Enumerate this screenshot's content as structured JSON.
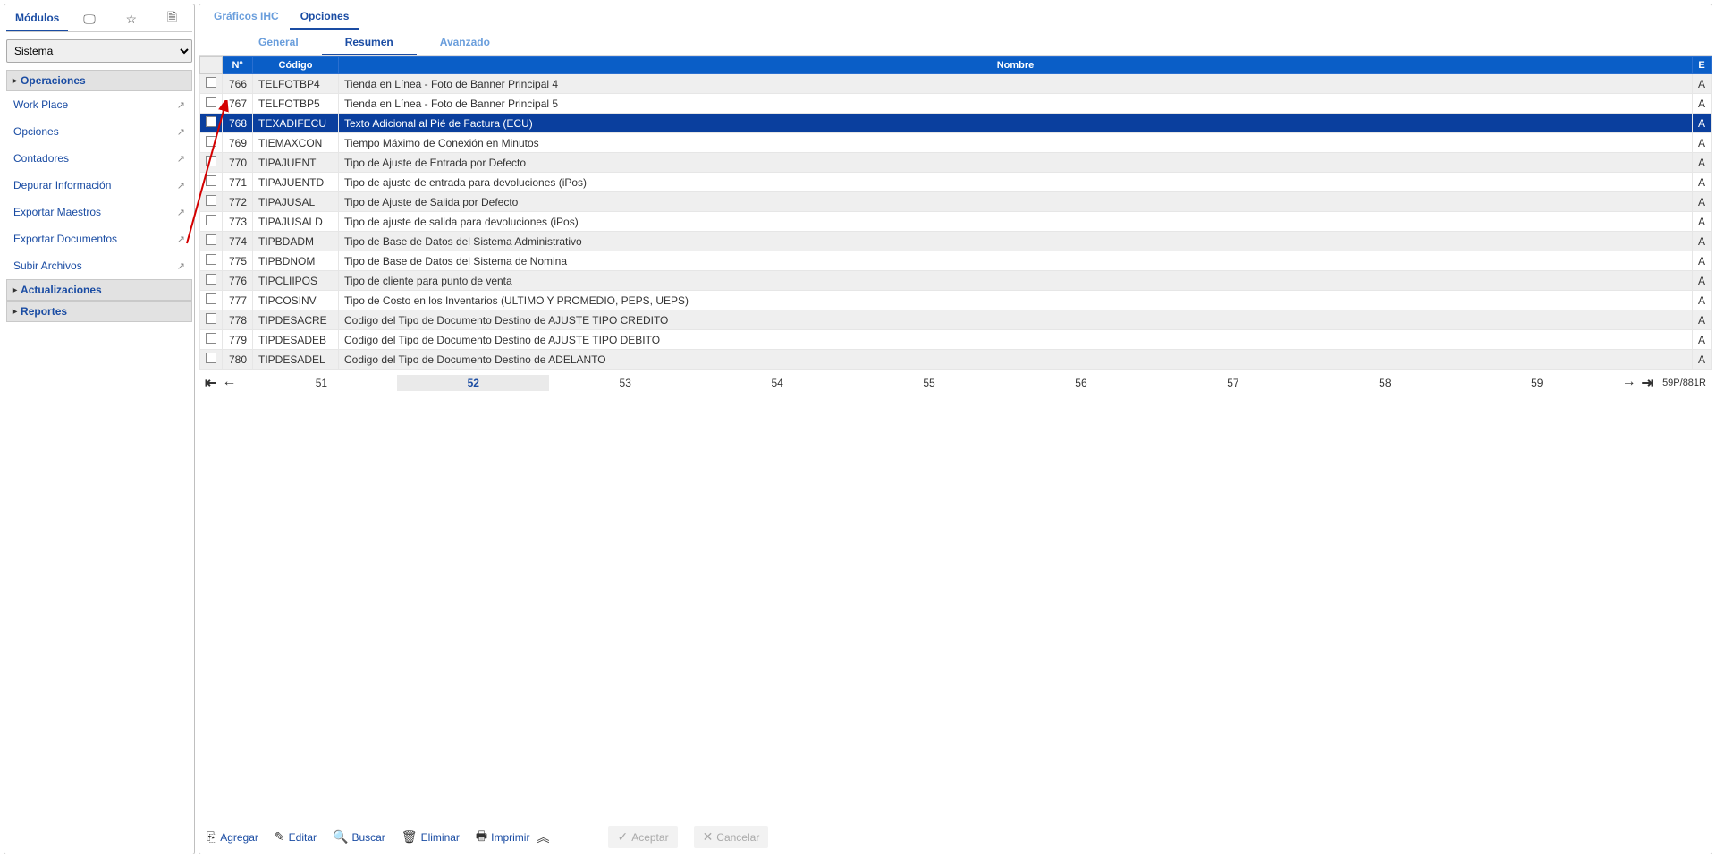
{
  "sidebar": {
    "tab_label": "Módulos",
    "select_value": "Sistema",
    "groups": [
      {
        "label": "Operaciones",
        "expanded": true,
        "items": [
          {
            "label": "Work Place"
          },
          {
            "label": "Opciones"
          },
          {
            "label": "Contadores"
          },
          {
            "label": "Depurar Información"
          },
          {
            "label": "Exportar Maestros"
          },
          {
            "label": "Exportar Documentos"
          },
          {
            "label": "Subir Archivos"
          }
        ]
      },
      {
        "label": "Actualizaciones",
        "expanded": false,
        "items": []
      },
      {
        "label": "Reportes",
        "expanded": false,
        "items": []
      }
    ]
  },
  "tabs": {
    "top": [
      {
        "label": "Gráficos IHC",
        "active": false
      },
      {
        "label": "Opciones",
        "active": true
      }
    ],
    "sub": [
      {
        "label": "General",
        "active": false
      },
      {
        "label": "Resumen",
        "active": true
      },
      {
        "label": "Avanzado",
        "active": false
      }
    ]
  },
  "grid": {
    "headers": {
      "num": "Nº",
      "code": "Código",
      "name": "Nombre",
      "status": "E"
    },
    "rows": [
      {
        "num": "766",
        "code": "TELFOTBP4",
        "name": "Tienda en Línea - Foto de Banner Principal 4",
        "status": "A",
        "selected": false
      },
      {
        "num": "767",
        "code": "TELFOTBP5",
        "name": "Tienda en Línea - Foto de Banner Principal 5",
        "status": "A",
        "selected": false
      },
      {
        "num": "768",
        "code": "TEXADIFECU",
        "name": "Texto Adicional al Pié de Factura (ECU)",
        "status": "A",
        "selected": true
      },
      {
        "num": "769",
        "code": "TIEMAXCON",
        "name": "Tiempo Máximo de Conexión en Minutos",
        "status": "A",
        "selected": false
      },
      {
        "num": "770",
        "code": "TIPAJUENT",
        "name": "Tipo de Ajuste de Entrada por Defecto",
        "status": "A",
        "selected": false
      },
      {
        "num": "771",
        "code": "TIPAJUENTD",
        "name": "Tipo de ajuste de entrada para devoluciones (iPos)",
        "status": "A",
        "selected": false
      },
      {
        "num": "772",
        "code": "TIPAJUSAL",
        "name": "Tipo de Ajuste de Salida por Defecto",
        "status": "A",
        "selected": false
      },
      {
        "num": "773",
        "code": "TIPAJUSALD",
        "name": "Tipo de ajuste de salida para devoluciones (iPos)",
        "status": "A",
        "selected": false
      },
      {
        "num": "774",
        "code": "TIPBDADM",
        "name": "Tipo de Base de Datos del Sistema Administrativo",
        "status": "A",
        "selected": false
      },
      {
        "num": "775",
        "code": "TIPBDNOM",
        "name": "Tipo de Base de Datos del Sistema de Nomina",
        "status": "A",
        "selected": false
      },
      {
        "num": "776",
        "code": "TIPCLIIPOS",
        "name": "Tipo de cliente para punto de venta",
        "status": "A",
        "selected": false
      },
      {
        "num": "777",
        "code": "TIPCOSINV",
        "name": "Tipo de Costo en los Inventarios (ULTIMO Y PROMEDIO, PEPS, UEPS)",
        "status": "A",
        "selected": false
      },
      {
        "num": "778",
        "code": "TIPDESACRE",
        "name": "Codigo del Tipo de Documento Destino de AJUSTE TIPO CREDITO",
        "status": "A",
        "selected": false
      },
      {
        "num": "779",
        "code": "TIPDESADEB",
        "name": "Codigo del Tipo de Documento Destino de AJUSTE TIPO DEBITO",
        "status": "A",
        "selected": false
      },
      {
        "num": "780",
        "code": "TIPDESADEL",
        "name": "Codigo del Tipo de Documento Destino de ADELANTO",
        "status": "A",
        "selected": false
      }
    ]
  },
  "pager": {
    "pages": [
      "51",
      "52",
      "53",
      "54",
      "55",
      "56",
      "57",
      "58",
      "59"
    ],
    "current": "52",
    "info": "59P/881R"
  },
  "toolbar": {
    "agregar": "Agregar",
    "editar": "Editar",
    "buscar": "Buscar",
    "eliminar": "Eliminar",
    "imprimir": "Imprimir",
    "aceptar": "Aceptar",
    "cancelar": "Cancelar"
  }
}
